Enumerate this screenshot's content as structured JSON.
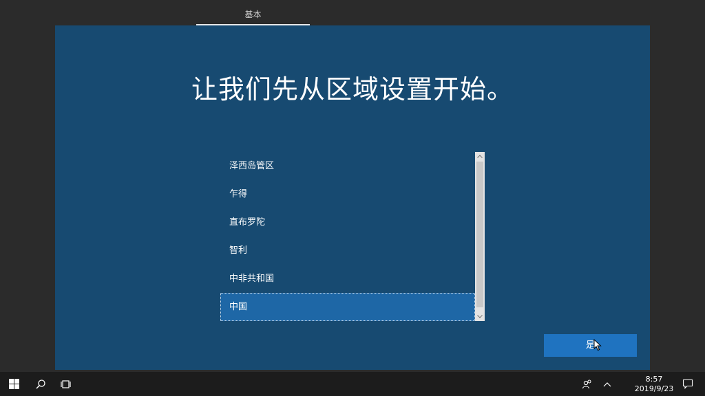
{
  "steps": [
    {
      "label": "基本"
    }
  ],
  "panel": {
    "heading": "让我们先从区域设置开始。",
    "regions": [
      "泽西岛管区",
      "乍得",
      "直布罗陀",
      "智利",
      "中非共和国",
      "中国"
    ],
    "selected_region": "中国",
    "yes_label": "是"
  },
  "taskbar": {
    "icons": [
      "windows-start-icon",
      "search-icon",
      "task-view-icon",
      "people-icon",
      "chevron-up-icon",
      "notification-icon"
    ],
    "time": "8:57",
    "date": "2019/9/23"
  }
}
